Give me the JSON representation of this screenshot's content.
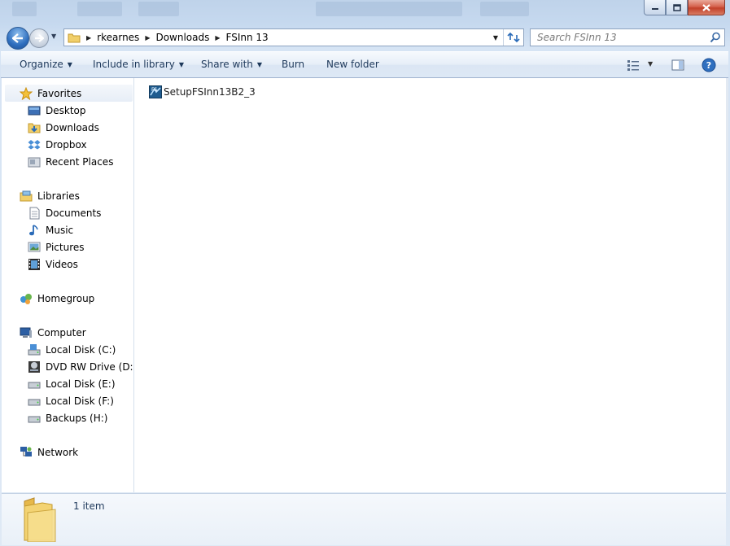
{
  "window": {
    "buttons": {
      "minimize": "minimize",
      "maximize": "maximize",
      "close": "close"
    }
  },
  "address": {
    "crumbs": [
      "rkearnes",
      "Downloads",
      "FSInn 13"
    ]
  },
  "search": {
    "placeholder": "Search FSInn 13"
  },
  "toolbar": {
    "organize": "Organize",
    "include_in_library": "Include in library",
    "share_with": "Share with",
    "burn": "Burn",
    "new_folder": "New folder"
  },
  "nav": {
    "favorites": {
      "label": "Favorites",
      "items": [
        "Desktop",
        "Downloads",
        "Dropbox",
        "Recent Places"
      ]
    },
    "libraries": {
      "label": "Libraries",
      "items": [
        "Documents",
        "Music",
        "Pictures",
        "Videos"
      ]
    },
    "homegroup": "Homegroup",
    "computer": {
      "label": "Computer",
      "items": [
        "Local Disk (C:)",
        "DVD RW Drive (D:) G",
        "Local Disk (E:)",
        "Local Disk (F:)",
        "Backups (H:)"
      ]
    },
    "network": "Network"
  },
  "files": [
    {
      "name": "SetupFSInn13B2_3"
    }
  ],
  "status": {
    "item_count": "1 item"
  },
  "colors": {
    "accent": "#1e395b",
    "selection": "#e7eef7",
    "close": "#c2412a"
  }
}
